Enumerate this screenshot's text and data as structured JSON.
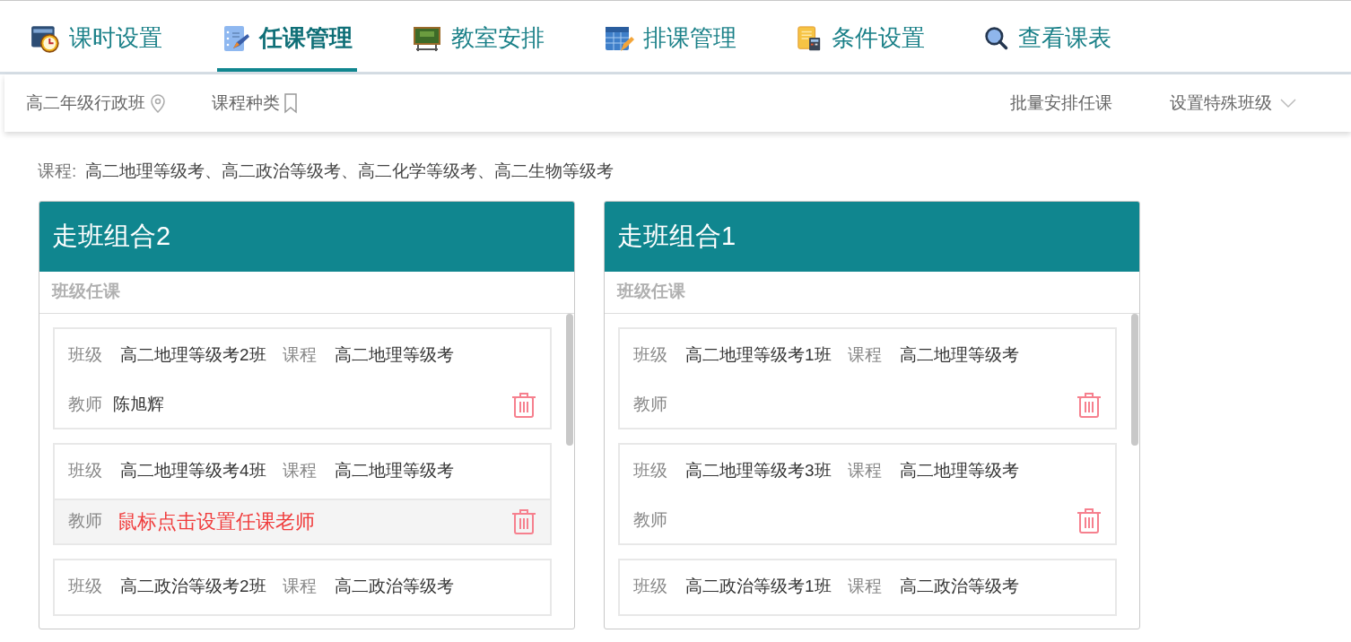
{
  "nav": [
    {
      "label": "课时设置",
      "selected": false
    },
    {
      "label": "任课管理",
      "selected": true
    },
    {
      "label": "教室安排",
      "selected": false
    },
    {
      "label": "排课管理",
      "selected": false
    },
    {
      "label": "条件设置",
      "selected": false
    },
    {
      "label": "查看课表",
      "selected": false
    }
  ],
  "filters": [
    {
      "label": "高二年级行政班"
    },
    {
      "label": "课程种类"
    }
  ],
  "actions": [
    {
      "label": "批量安排任课"
    },
    {
      "label": "设置特殊班级",
      "dropdown": true
    }
  ],
  "course_line": {
    "label": "课程:",
    "value": "高二地理等级考、高二政治等级考、高二化学等级考、高二生物等级考"
  },
  "groups": [
    {
      "title": "走班组合2",
      "section": "班级任课",
      "items": [
        {
          "class_label": "班级",
          "class": "高二地理等级考2班",
          "course_label": "课程",
          "course": "高二地理等级考",
          "teacher_label": "教师",
          "teacher": "陈旭辉",
          "hover": false
        },
        {
          "class_label": "班级",
          "class": "高二地理等级考4班",
          "course_label": "课程",
          "course": "高二地理等级考",
          "teacher_label": "教师",
          "teacher_prompt": "鼠标点击设置任课老师",
          "hover": true
        },
        {
          "class_label": "班级",
          "class": "高二政治等级考2班",
          "course_label": "课程",
          "course": "高二政治等级考"
        }
      ]
    },
    {
      "title": "走班组合1",
      "section": "班级任课",
      "items": [
        {
          "class_label": "班级",
          "class": "高二地理等级考1班",
          "course_label": "课程",
          "course": "高二地理等级考",
          "teacher_label": "教师",
          "hover": false
        },
        {
          "class_label": "班级",
          "class": "高二地理等级考3班",
          "course_label": "课程",
          "course": "高二地理等级考",
          "teacher_label": "教师",
          "hover": false
        },
        {
          "class_label": "班级",
          "class": "高二政治等级考1班",
          "course_label": "课程",
          "course": "高二政治等级考"
        }
      ]
    }
  ]
}
